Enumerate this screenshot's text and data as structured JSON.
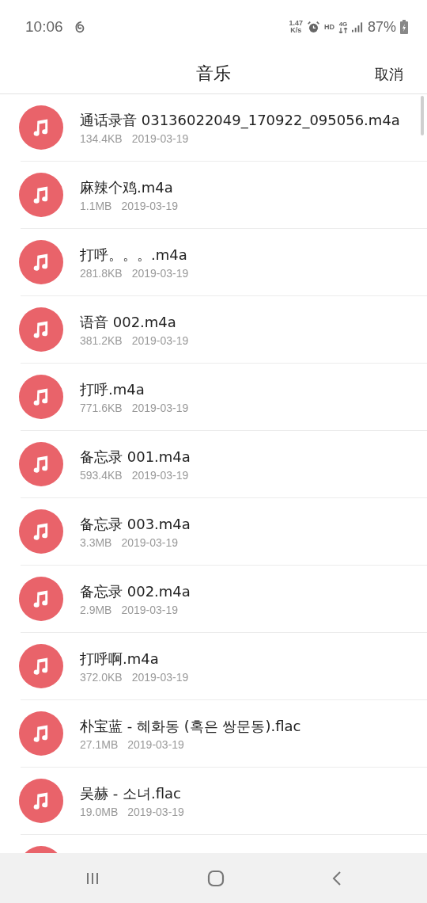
{
  "status_bar": {
    "time": "10:06",
    "net_speed": "1.47",
    "net_speed_unit": "K/s",
    "hd": "HD",
    "network": "4G",
    "battery": "87%"
  },
  "header": {
    "title": "音乐",
    "cancel": "取消"
  },
  "files": [
    {
      "kind": "file",
      "name": "通话录音 03136022049_170922_095056.m4a",
      "size": "134.4KB",
      "date": "2019-03-19"
    },
    {
      "kind": "file",
      "name": "麻辣个鸡.m4a",
      "size": "1.1MB",
      "date": "2019-03-19"
    },
    {
      "kind": "file",
      "name": "打呼。。。.m4a",
      "size": "281.8KB",
      "date": "2019-03-19"
    },
    {
      "kind": "file",
      "name": "语音 002.m4a",
      "size": "381.2KB",
      "date": "2019-03-19"
    },
    {
      "kind": "file",
      "name": "打呼.m4a",
      "size": "771.6KB",
      "date": "2019-03-19"
    },
    {
      "kind": "file",
      "name": "备忘录 001.m4a",
      "size": "593.4KB",
      "date": "2019-03-19"
    },
    {
      "kind": "file",
      "name": "备忘录 003.m4a",
      "size": "3.3MB",
      "date": "2019-03-19"
    },
    {
      "kind": "file",
      "name": "备忘录 002.m4a",
      "size": "2.9MB",
      "date": "2019-03-19"
    },
    {
      "kind": "file",
      "name": "打呼啊.m4a",
      "size": "372.0KB",
      "date": "2019-03-19"
    },
    {
      "kind": "file",
      "name": "朴宝蓝 - 혜화동 (혹은 쌍문동).flac",
      "size": "27.1MB",
      "date": "2019-03-19"
    },
    {
      "kind": "file",
      "name": "吴赫 - 소녀.flac",
      "size": "19.0MB",
      "date": "2019-03-19"
    },
    {
      "kind": "peek"
    }
  ]
}
